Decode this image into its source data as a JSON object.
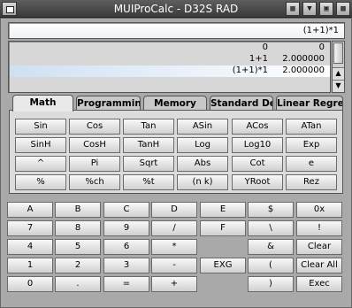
{
  "window": {
    "title": "MUIProCalc - D32S RAD"
  },
  "display": {
    "entry": "(1+1)*1",
    "history": [
      {
        "expr": "0",
        "result": "0"
      },
      {
        "expr": "1+1",
        "result": "2.000000"
      },
      {
        "expr": "(1+1)*1",
        "result": "2.000000"
      }
    ]
  },
  "tabs": [
    "Math",
    "Programmin",
    "Memory",
    "Standard De",
    "Linear Regre"
  ],
  "math_keys": [
    [
      "Sin",
      "Cos",
      "Tan",
      "ASin",
      "ACos",
      "ATan"
    ],
    [
      "SinH",
      "CosH",
      "TanH",
      "Log",
      "Log10",
      "Exp"
    ],
    [
      "^",
      "Pi",
      "Sqrt",
      "Abs",
      "Cot",
      "e"
    ],
    [
      "%",
      "%ch",
      "%t",
      "(n k)",
      "YRoot",
      "Rez"
    ]
  ],
  "keypad": [
    [
      "A",
      "B",
      "C",
      "D",
      "E",
      "$",
      "0x"
    ],
    [
      "7",
      "8",
      "9",
      "/",
      "F",
      "\\",
      "!"
    ],
    [
      "4",
      "5",
      "6",
      "*",
      "",
      "&",
      "Clear"
    ],
    [
      "1",
      "2",
      "3",
      "-",
      "EXG",
      "(",
      "Clear All"
    ],
    [
      "0",
      ".",
      "=",
      "+",
      "",
      ")",
      "Exec"
    ]
  ],
  "icons": {
    "title_gadgets": [
      "iconify-gadget",
      "jump-gadget",
      "zoom-gadget",
      "depth-gadget"
    ]
  }
}
